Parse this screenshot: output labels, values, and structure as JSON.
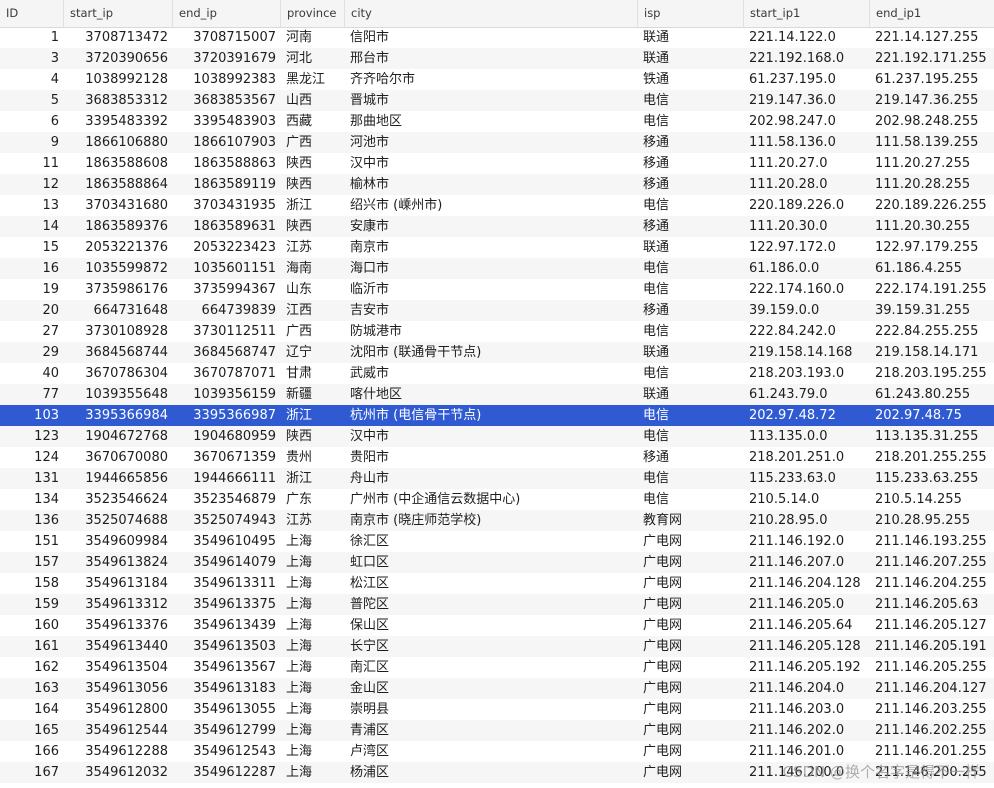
{
  "columns": [
    "ID",
    "start_ip",
    "end_ip",
    "province",
    "city",
    "isp",
    "start_ip1",
    "end_ip1"
  ],
  "selected_row_index": 18,
  "colors": {
    "selection": "#2f5ad2",
    "header_bg": "#f5f5f5",
    "alt_row": "#f6f6f6"
  },
  "rows": [
    [
      "1",
      "3708713472",
      "3708715007",
      "河南",
      "信阳市",
      "联通",
      "221.14.122.0",
      "221.14.127.255"
    ],
    [
      "3",
      "3720390656",
      "3720391679",
      "河北",
      "邢台市",
      "联通",
      "221.192.168.0",
      "221.192.171.255"
    ],
    [
      "4",
      "1038992128",
      "1038992383",
      "黑龙江",
      "齐齐哈尔市",
      "铁通",
      "61.237.195.0",
      "61.237.195.255"
    ],
    [
      "5",
      "3683853312",
      "3683853567",
      "山西",
      "晋城市",
      "电信",
      "219.147.36.0",
      "219.147.36.255"
    ],
    [
      "6",
      "3395483392",
      "3395483903",
      "西藏",
      "那曲地区",
      "电信",
      "202.98.247.0",
      "202.98.248.255"
    ],
    [
      "9",
      "1866106880",
      "1866107903",
      "广西",
      "河池市",
      "移通",
      "111.58.136.0",
      "111.58.139.255"
    ],
    [
      "11",
      "1863588608",
      "1863588863",
      "陕西",
      "汉中市",
      "移通",
      "111.20.27.0",
      "111.20.27.255"
    ],
    [
      "12",
      "1863588864",
      "1863589119",
      "陕西",
      "榆林市",
      "移通",
      "111.20.28.0",
      "111.20.28.255"
    ],
    [
      "13",
      "3703431680",
      "3703431935",
      "浙江",
      "绍兴市 (嵊州市)",
      "电信",
      "220.189.226.0",
      "220.189.226.255"
    ],
    [
      "14",
      "1863589376",
      "1863589631",
      "陕西",
      "安康市",
      "移通",
      "111.20.30.0",
      "111.20.30.255"
    ],
    [
      "15",
      "2053221376",
      "2053223423",
      "江苏",
      "南京市",
      "联通",
      "122.97.172.0",
      "122.97.179.255"
    ],
    [
      "16",
      "1035599872",
      "1035601151",
      "海南",
      "海口市",
      "电信",
      "61.186.0.0",
      "61.186.4.255"
    ],
    [
      "19",
      "3735986176",
      "3735994367",
      "山东",
      "临沂市",
      "电信",
      "222.174.160.0",
      "222.174.191.255"
    ],
    [
      "20",
      "664731648",
      "664739839",
      "江西",
      "吉安市",
      "移通",
      "39.159.0.0",
      "39.159.31.255"
    ],
    [
      "27",
      "3730108928",
      "3730112511",
      "广西",
      "防城港市",
      "电信",
      "222.84.242.0",
      "222.84.255.255"
    ],
    [
      "29",
      "3684568744",
      "3684568747",
      "辽宁",
      "沈阳市 (联通骨干节点)",
      "联通",
      "219.158.14.168",
      "219.158.14.171"
    ],
    [
      "40",
      "3670786304",
      "3670787071",
      "甘肃",
      "武威市",
      "电信",
      "218.203.193.0",
      "218.203.195.255"
    ],
    [
      "77",
      "1039355648",
      "1039356159",
      "新疆",
      "喀什地区",
      "联通",
      "61.243.79.0",
      "61.243.80.255"
    ],
    [
      "103",
      "3395366984",
      "3395366987",
      "浙江",
      "杭州市 (电信骨干节点)",
      "电信",
      "202.97.48.72",
      "202.97.48.75"
    ],
    [
      "123",
      "1904672768",
      "1904680959",
      "陕西",
      "汉中市",
      "电信",
      "113.135.0.0",
      "113.135.31.255"
    ],
    [
      "124",
      "3670670080",
      "3670671359",
      "贵州",
      "贵阳市",
      "移通",
      "218.201.251.0",
      "218.201.255.255"
    ],
    [
      "131",
      "1944665856",
      "1944666111",
      "浙江",
      "舟山市",
      "电信",
      "115.233.63.0",
      "115.233.63.255"
    ],
    [
      "134",
      "3523546624",
      "3523546879",
      "广东",
      "广州市 (中企通信云数据中心)",
      "电信",
      "210.5.14.0",
      "210.5.14.255"
    ],
    [
      "136",
      "3525074688",
      "3525074943",
      "江苏",
      "南京市 (晓庄师范学校)",
      "教育网",
      "210.28.95.0",
      "210.28.95.255"
    ],
    [
      "151",
      "3549609984",
      "3549610495",
      "上海",
      "徐汇区",
      "广电网",
      "211.146.192.0",
      "211.146.193.255"
    ],
    [
      "157",
      "3549613824",
      "3549614079",
      "上海",
      "虹口区",
      "广电网",
      "211.146.207.0",
      "211.146.207.255"
    ],
    [
      "158",
      "3549613184",
      "3549613311",
      "上海",
      "松江区",
      "广电网",
      "211.146.204.128",
      "211.146.204.255"
    ],
    [
      "159",
      "3549613312",
      "3549613375",
      "上海",
      "普陀区",
      "广电网",
      "211.146.205.0",
      "211.146.205.63"
    ],
    [
      "160",
      "3549613376",
      "3549613439",
      "上海",
      "保山区",
      "广电网",
      "211.146.205.64",
      "211.146.205.127"
    ],
    [
      "161",
      "3549613440",
      "3549613503",
      "上海",
      "长宁区",
      "广电网",
      "211.146.205.128",
      "211.146.205.191"
    ],
    [
      "162",
      "3549613504",
      "3549613567",
      "上海",
      "南汇区",
      "广电网",
      "211.146.205.192",
      "211.146.205.255"
    ],
    [
      "163",
      "3549613056",
      "3549613183",
      "上海",
      "金山区",
      "广电网",
      "211.146.204.0",
      "211.146.204.127"
    ],
    [
      "164",
      "3549612800",
      "3549613055",
      "上海",
      "崇明县",
      "广电网",
      "211.146.203.0",
      "211.146.203.255"
    ],
    [
      "165",
      "3549612544",
      "3549612799",
      "上海",
      "青浦区",
      "广电网",
      "211.146.202.0",
      "211.146.202.255"
    ],
    [
      "166",
      "3549612288",
      "3549612543",
      "上海",
      "卢湾区",
      "广电网",
      "211.146.201.0",
      "211.146.201.255"
    ],
    [
      "167",
      "3549612032",
      "3549612287",
      "上海",
      "杨浦区",
      "广电网",
      "211.146.200.0",
      "211.146.200.255"
    ]
  ],
  "watermark": "CSDN @换个名字是得不一样"
}
